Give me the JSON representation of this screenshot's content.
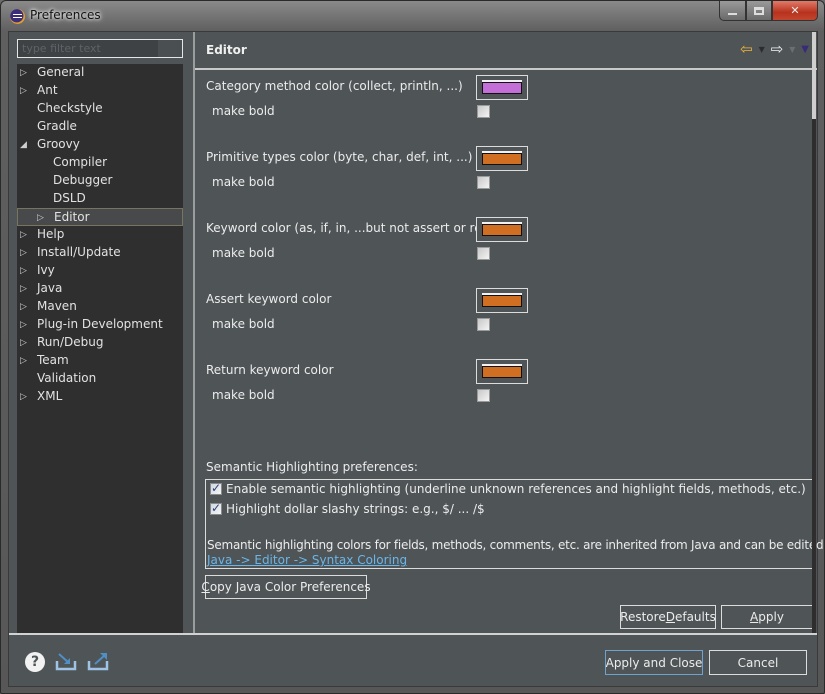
{
  "window": {
    "title": "Preferences",
    "controls": {
      "minimize": "minimize",
      "maximize": "maximize",
      "close": "close"
    }
  },
  "sidebar": {
    "filter_placeholder": "type filter text",
    "filter_value": "",
    "items": [
      {
        "label": "General",
        "level": 0,
        "expander": "collapsed"
      },
      {
        "label": "Ant",
        "level": 0,
        "expander": "collapsed"
      },
      {
        "label": "Checkstyle",
        "level": 0,
        "expander": "none"
      },
      {
        "label": "Gradle",
        "level": 0,
        "expander": "none"
      },
      {
        "label": "Groovy",
        "level": 0,
        "expander": "expanded"
      },
      {
        "label": "Compiler",
        "level": 1,
        "expander": "none"
      },
      {
        "label": "Debugger",
        "level": 1,
        "expander": "none"
      },
      {
        "label": "DSLD",
        "level": 1,
        "expander": "none"
      },
      {
        "label": "Editor",
        "level": 1,
        "expander": "collapsed",
        "selected": true
      },
      {
        "label": "Help",
        "level": 0,
        "expander": "collapsed"
      },
      {
        "label": "Install/Update",
        "level": 0,
        "expander": "collapsed"
      },
      {
        "label": "Ivy",
        "level": 0,
        "expander": "collapsed"
      },
      {
        "label": "Java",
        "level": 0,
        "expander": "collapsed"
      },
      {
        "label": "Maven",
        "level": 0,
        "expander": "collapsed"
      },
      {
        "label": "Plug-in Development",
        "level": 0,
        "expander": "collapsed"
      },
      {
        "label": "Run/Debug",
        "level": 0,
        "expander": "collapsed"
      },
      {
        "label": "Team",
        "level": 0,
        "expander": "collapsed"
      },
      {
        "label": "Validation",
        "level": 0,
        "expander": "none"
      },
      {
        "label": "XML",
        "level": 0,
        "expander": "collapsed"
      }
    ]
  },
  "page": {
    "title": "Editor",
    "nav": {
      "back_icon": "back-arrow-icon",
      "forward_icon": "forward-arrow-icon",
      "menu_icon": "view-menu-icon"
    },
    "color_prefs": [
      {
        "label": "Category method color (collect, println, ...)",
        "color": "#c46fd8",
        "bold_label": "make bold",
        "bold": false
      },
      {
        "label": "Primitive types color (byte, char, def, int, ...)",
        "color": "#d06f22",
        "bold_label": "make bold",
        "bold": false
      },
      {
        "label": "Keyword color (as, if, in, ...but not assert or return)",
        "color": "#d06f22",
        "bold_label": "make bold",
        "bold": false
      },
      {
        "label": "Assert keyword color",
        "color": "#d06f22",
        "bold_label": "make bold",
        "bold": false
      },
      {
        "label": "Return keyword color",
        "color": "#d06f22",
        "bold_label": "make bold",
        "bold": false
      }
    ],
    "semantic": {
      "heading": "Semantic Highlighting preferences:",
      "enable_label": "Enable semantic highlighting (underline unknown references and highlight fields, methods, etc.)",
      "enable_checked": true,
      "dollar_label": "Highlight dollar slashy strings: e.g., $/ ... /$",
      "dollar_checked": true,
      "note": "Semantic highlighting colors for fields, methods, comments, etc. are inherited from Java and can be edited here:",
      "link": "Java -> Editor -> Syntax Coloring"
    },
    "copy_button": {
      "mnemonic": "C",
      "rest": "opy Java Color Preferences"
    },
    "restore_button": {
      "before": "Restore ",
      "mnemonic": "D",
      "after": "efaults"
    },
    "apply_button": {
      "mnemonic": "A",
      "rest": "pply"
    }
  },
  "footer": {
    "help_icon": "help-icon",
    "import_icon": "import-icon",
    "export_icon": "export-icon",
    "apply_close": "Apply and Close",
    "cancel": "Cancel"
  },
  "colors": {
    "background": "#4f5457",
    "tree_background": "#2f2f2f",
    "link": "#6ab6e8",
    "default_button_border": "#6ea2cf"
  }
}
